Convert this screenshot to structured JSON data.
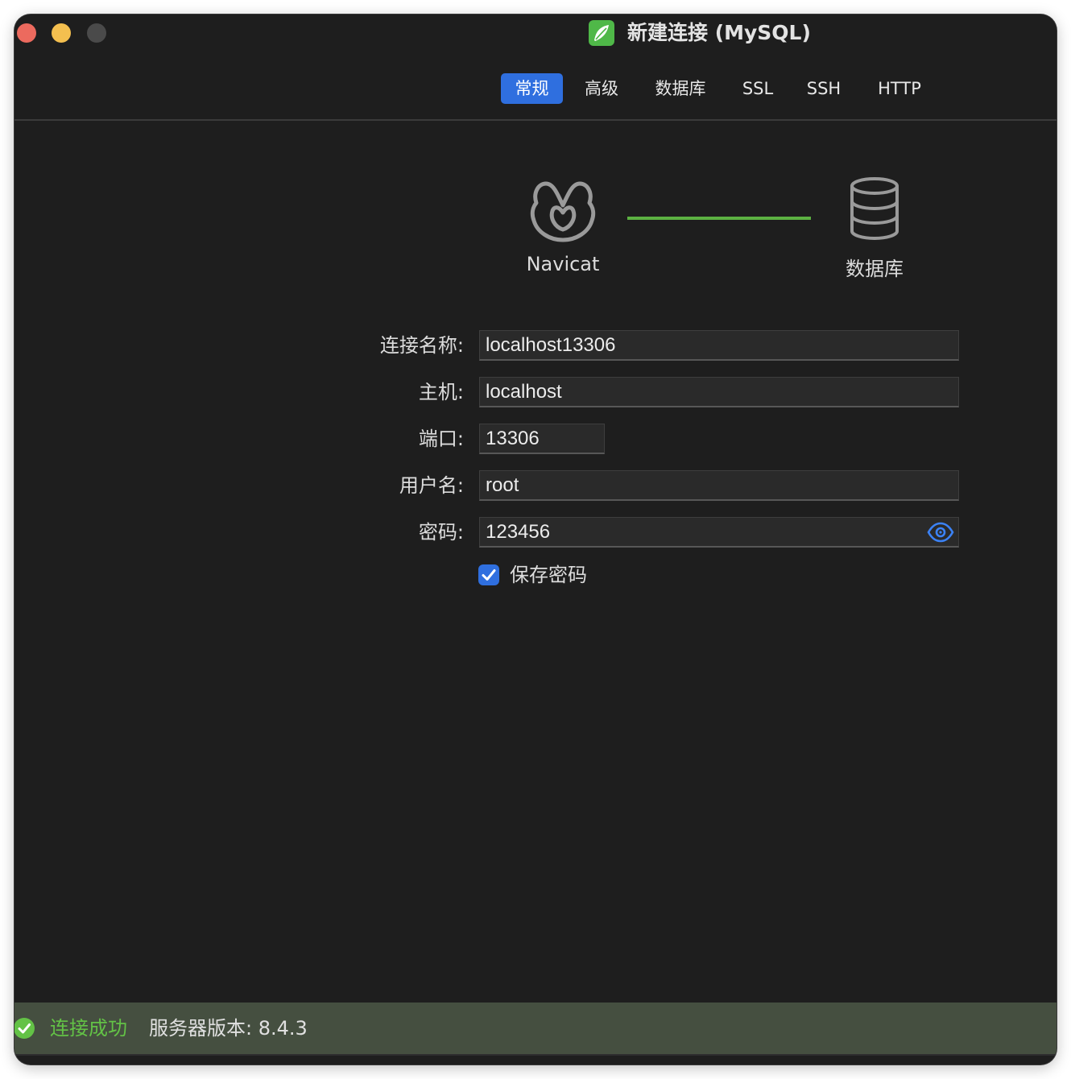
{
  "window": {
    "title": "新建连接 (MySQL)",
    "app_icon": "navicat-leaf-icon"
  },
  "tabs": [
    {
      "label": "常规",
      "active": true
    },
    {
      "label": "高级",
      "active": false
    },
    {
      "label": "数据库",
      "active": false
    },
    {
      "label": "SSL",
      "active": false
    },
    {
      "label": "SSH",
      "active": false
    },
    {
      "label": "HTTP",
      "active": false
    }
  ],
  "diagram": {
    "left_label": "Navicat",
    "right_label": "数据库",
    "connection_status_color": "#5cb142"
  },
  "form": {
    "connection_name": {
      "label": "连接名称:",
      "value": "localhost13306"
    },
    "host": {
      "label": "主机:",
      "value": "localhost"
    },
    "port": {
      "label": "端口:",
      "value": "13306"
    },
    "username": {
      "label": "用户名:",
      "value": "root"
    },
    "password": {
      "label": "密码:",
      "value": "123456",
      "reveal_icon": "eye-icon"
    },
    "save_password": {
      "label": "保存密码",
      "checked": true
    }
  },
  "status": {
    "result": "连接成功",
    "version_text": "服务器版本: 8.4.3",
    "icon": "check-circle-icon",
    "color": "#63c246"
  },
  "colors": {
    "accent": "#2f6fdf",
    "background": "#1e1e1e",
    "status_bar": "#454f40"
  }
}
